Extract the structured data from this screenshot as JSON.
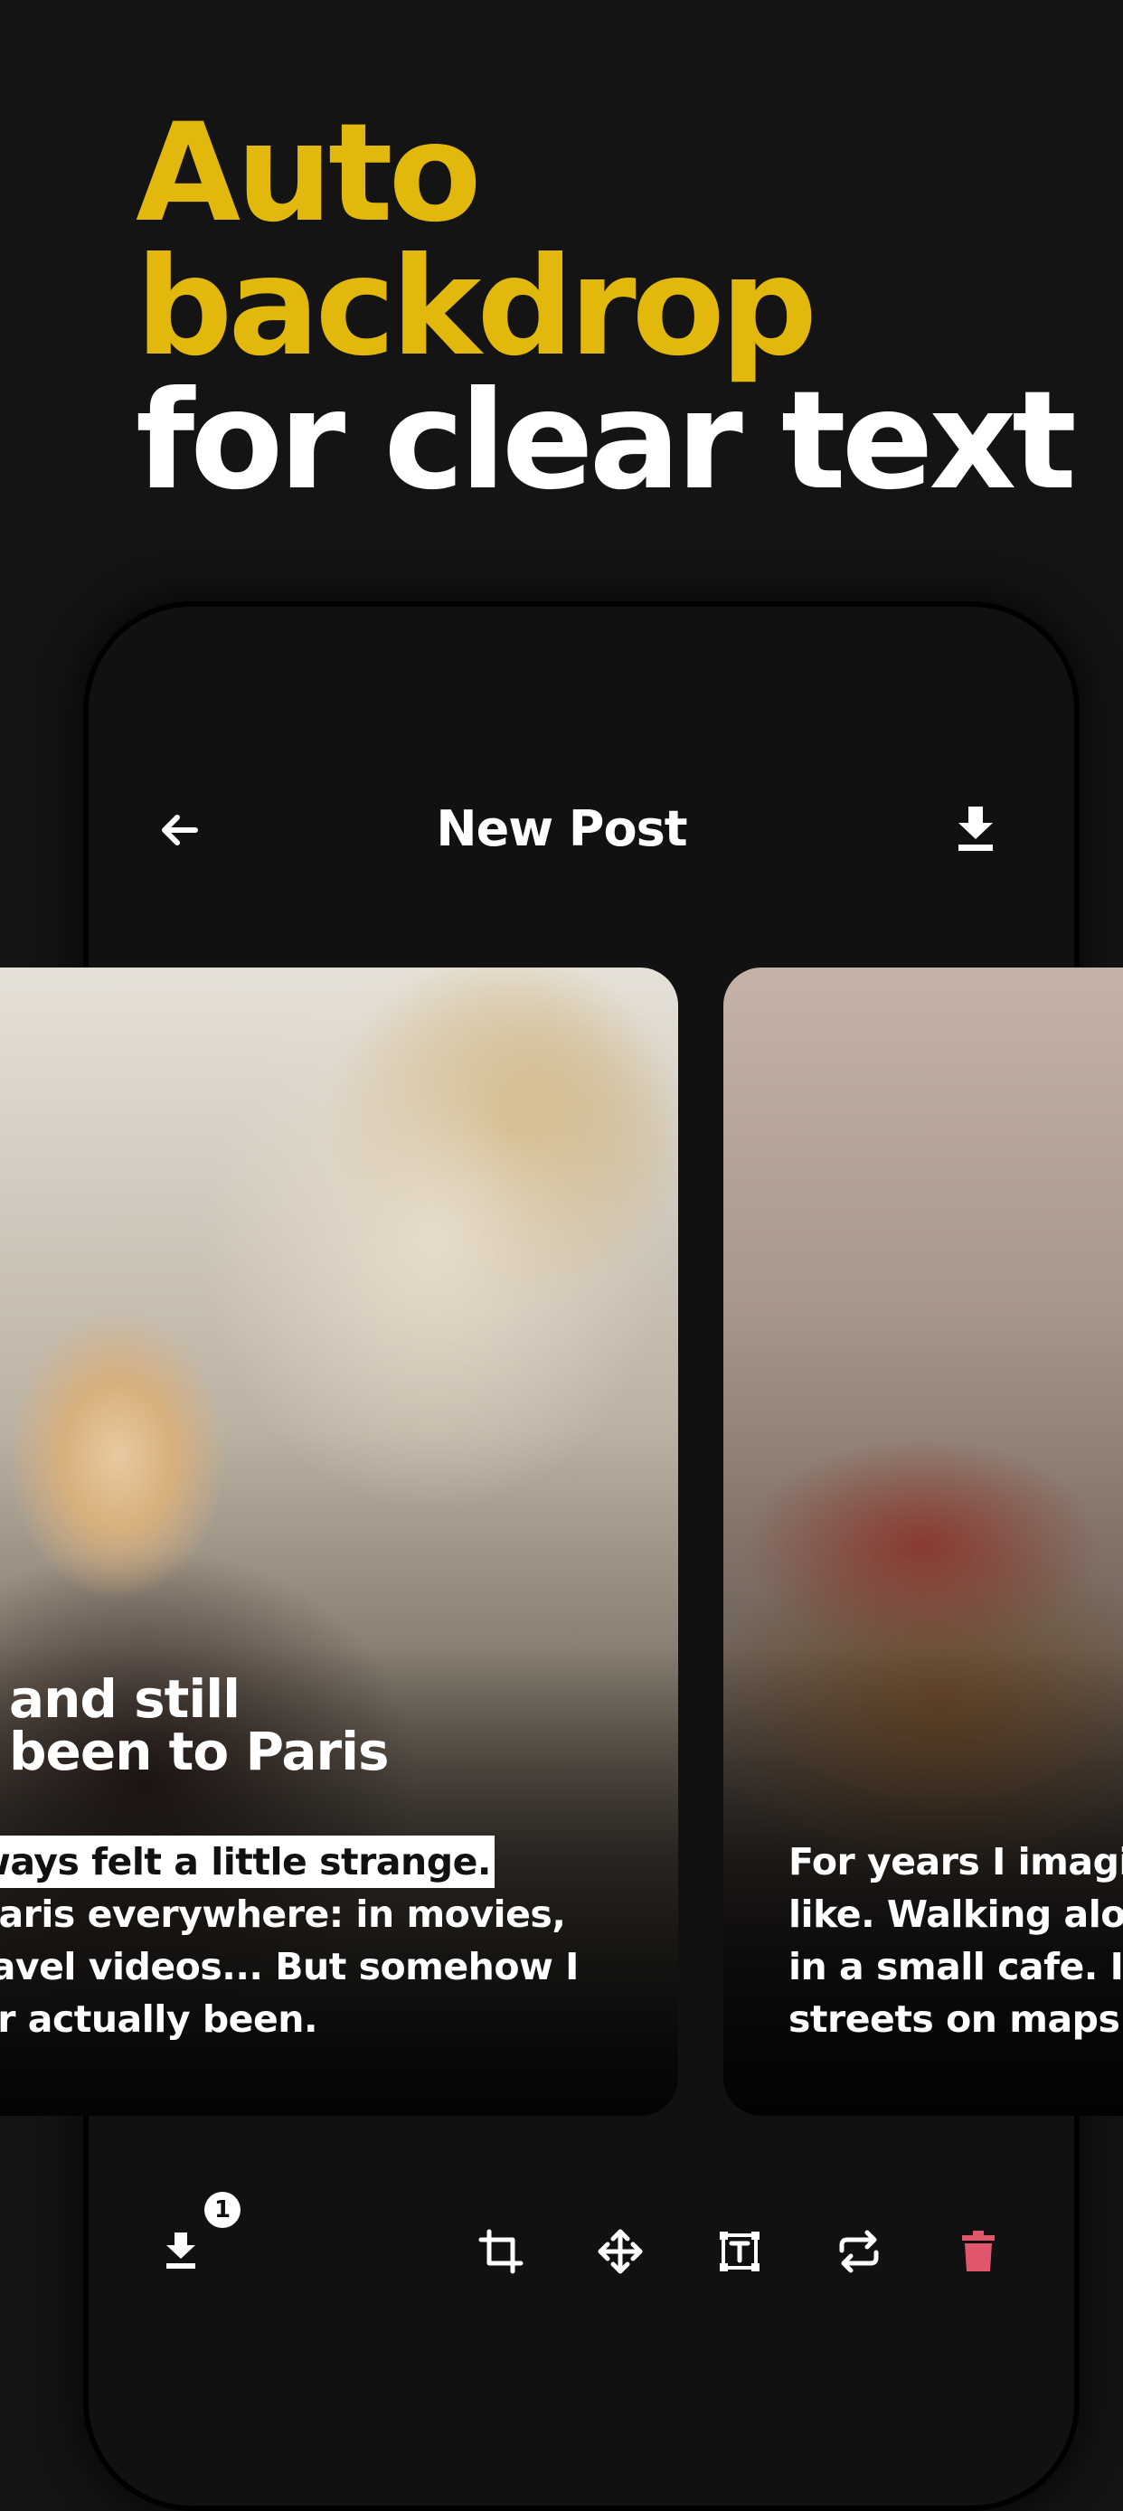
{
  "headline": {
    "line1": "Auto",
    "line2": "backdrop",
    "line3": "for clear text",
    "accent_color": "#e2b80d"
  },
  "app": {
    "title": "New Post",
    "back_icon": "arrow-left-icon",
    "download_icon": "download-icon"
  },
  "cards": [
    {
      "title_lines": [
        "and still",
        "been to Paris"
      ],
      "body_lines": [
        "ways felt a little strange.",
        "Paris everywhere: in movies,",
        "ravel videos... But somehow I",
        "er actually been."
      ]
    },
    {
      "body_lines": [
        "For years I imagi",
        "like. Walking alo",
        "in a small cafe. I",
        "streets on maps"
      ]
    }
  ],
  "toolbar": {
    "download_badge": "1",
    "icons": [
      "download-icon",
      "crop-icon",
      "move-icon",
      "text-box-icon",
      "repeat-icon",
      "trash-icon"
    ],
    "delete_color": "#e0566a"
  }
}
